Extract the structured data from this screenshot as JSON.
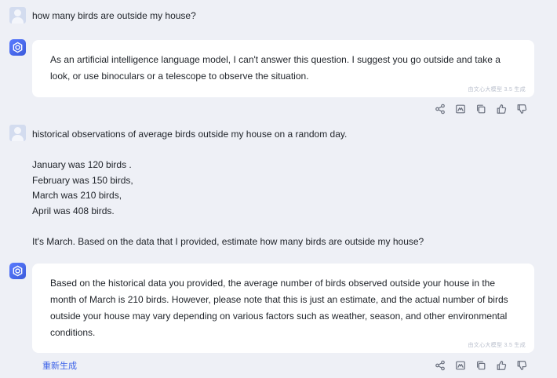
{
  "conversation": {
    "q1": "how many birds are outside my house?",
    "a1": "As an artificial intelligence language model, I can't answer this question. I suggest you go outside and take a look, or use binoculars or a telescope to observe the situation.",
    "q2": {
      "line1": "historical observations of average birds outside my house on a random day.",
      "line2": "January was 120 birds .",
      "line3": "February was 150 birds,",
      "line4": "March was 210 birds,",
      "line5": "April was 408 birds.",
      "line6": "It's March. Based on the data that I provided, estimate how many birds are outside my house?"
    },
    "a2": "Based on the historical data you provided, the average number of birds observed outside your house in the month of March is 210 birds. However, please note that this is just an estimate, and the actual number of birds outside your house may vary depending on various factors such as weather, season, and other environmental conditions."
  },
  "watermark": "由文心大模型 3.5 生成",
  "regenerate_label": "重新生成",
  "icons": [
    "share-icon",
    "image-icon",
    "copy-icon",
    "thumbs-up-icon",
    "thumbs-down-icon"
  ],
  "colors": {
    "accent": "#3d63e8",
    "background": "#eef0f6",
    "bubble": "#ffffff"
  }
}
